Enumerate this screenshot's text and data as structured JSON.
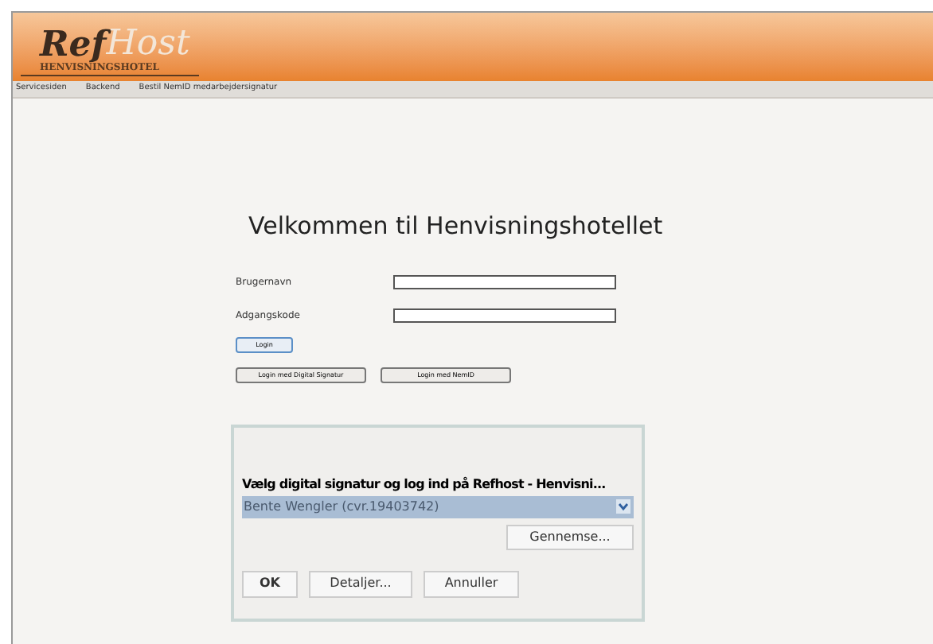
{
  "logo": {
    "part_1": "Ref",
    "part_2": "Host",
    "subtitle": "HENVISNINGSHOTEL"
  },
  "nav": [
    {
      "label": "Servicesiden"
    },
    {
      "label": "Backend"
    },
    {
      "label": "Bestil NemID medarbejdersignatur"
    }
  ],
  "heading": "Velkommen til Henvisningshotellet",
  "form": {
    "fields": [
      {
        "label": "Brugernavn"
      },
      {
        "label": "Adgangskode"
      }
    ],
    "login_button": "Login",
    "alt_buttons": [
      "Login med Digital Signatur",
      "Login med NemID"
    ]
  },
  "applet": {
    "prompt": "Vælg digital signatur og log ind på Refhost - Henvisni...",
    "selected_certificate": "Bente Wengler (cvr.19403742)",
    "browse_button": "Gennemse...",
    "buttons": [
      "OK",
      "Detaljer...",
      "Annuller"
    ]
  }
}
